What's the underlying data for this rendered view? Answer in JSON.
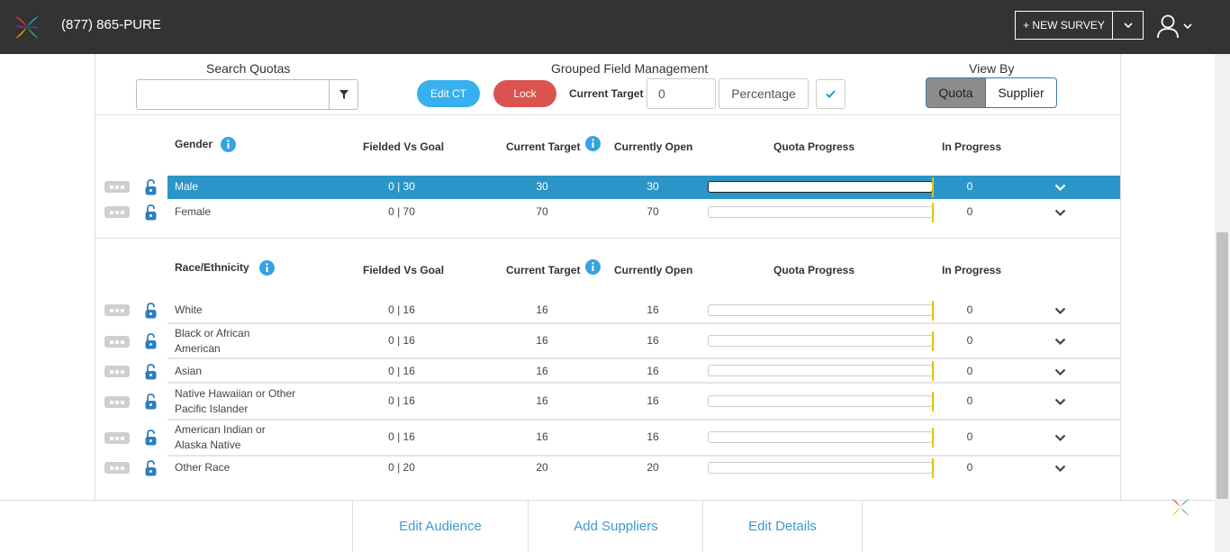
{
  "header": {
    "phone": "(877) 865-PURE",
    "new_survey_label": "+ NEW SURVEY"
  },
  "toolbar": {
    "search_label": "Search Quotas",
    "search_placeholder": "",
    "grouped_label": "Grouped Field Management",
    "edit_ct_label": "Edit CT",
    "lock_label": "Lock",
    "current_target_label": "Current Target",
    "current_target_value": "0",
    "percentage_label": "Percentage",
    "view_by_label": "View By",
    "view_quota_label": "Quota",
    "view_supplier_label": "Supplier"
  },
  "columns": {
    "fielded": "Fielded Vs Goal",
    "current_target": "Current Target",
    "currently_open": "Currently Open",
    "quota_progress": "Quota Progress",
    "in_progress": "In Progress"
  },
  "groups": [
    {
      "title": "Gender",
      "rows": [
        {
          "name": "Male",
          "fielded": "0 | 30",
          "target": "30",
          "open": "30",
          "in_progress": "0",
          "progress": 0,
          "selected": true
        },
        {
          "name": "Female",
          "fielded": "0 | 70",
          "target": "70",
          "open": "70",
          "in_progress": "0",
          "progress": 0,
          "selected": false
        }
      ]
    },
    {
      "title": "Race/Ethnicity",
      "rows": [
        {
          "name": "White",
          "fielded": "0 | 16",
          "target": "16",
          "open": "16",
          "in_progress": "0",
          "progress": 0
        },
        {
          "name": "Black or African American",
          "fielded": "0 | 16",
          "target": "16",
          "open": "16",
          "in_progress": "0",
          "progress": 0
        },
        {
          "name": "Asian",
          "fielded": "0 | 16",
          "target": "16",
          "open": "16",
          "in_progress": "0",
          "progress": 0
        },
        {
          "name": "Native Hawaiian or Other Pacific Islander",
          "fielded": "0 | 16",
          "target": "16",
          "open": "16",
          "in_progress": "0",
          "progress": 0
        },
        {
          "name": "American Indian or Alaska Native",
          "fielded": "0 | 16",
          "target": "16",
          "open": "16",
          "in_progress": "0",
          "progress": 0
        },
        {
          "name": "Other Race",
          "fielded": "0 | 20",
          "target": "20",
          "open": "20",
          "in_progress": "0",
          "progress": 0
        }
      ]
    }
  ],
  "footer": {
    "edit_audience": "Edit Audience",
    "add_suppliers": "Add Suppliers",
    "edit_details": "Edit Details"
  },
  "colors": {
    "topbar": "#333333",
    "accent_blue": "#2b95c7",
    "edit_ct": "#36b0ee",
    "lock": "#d9534f",
    "marker": "#e5c300",
    "link": "#3a9bd5"
  }
}
